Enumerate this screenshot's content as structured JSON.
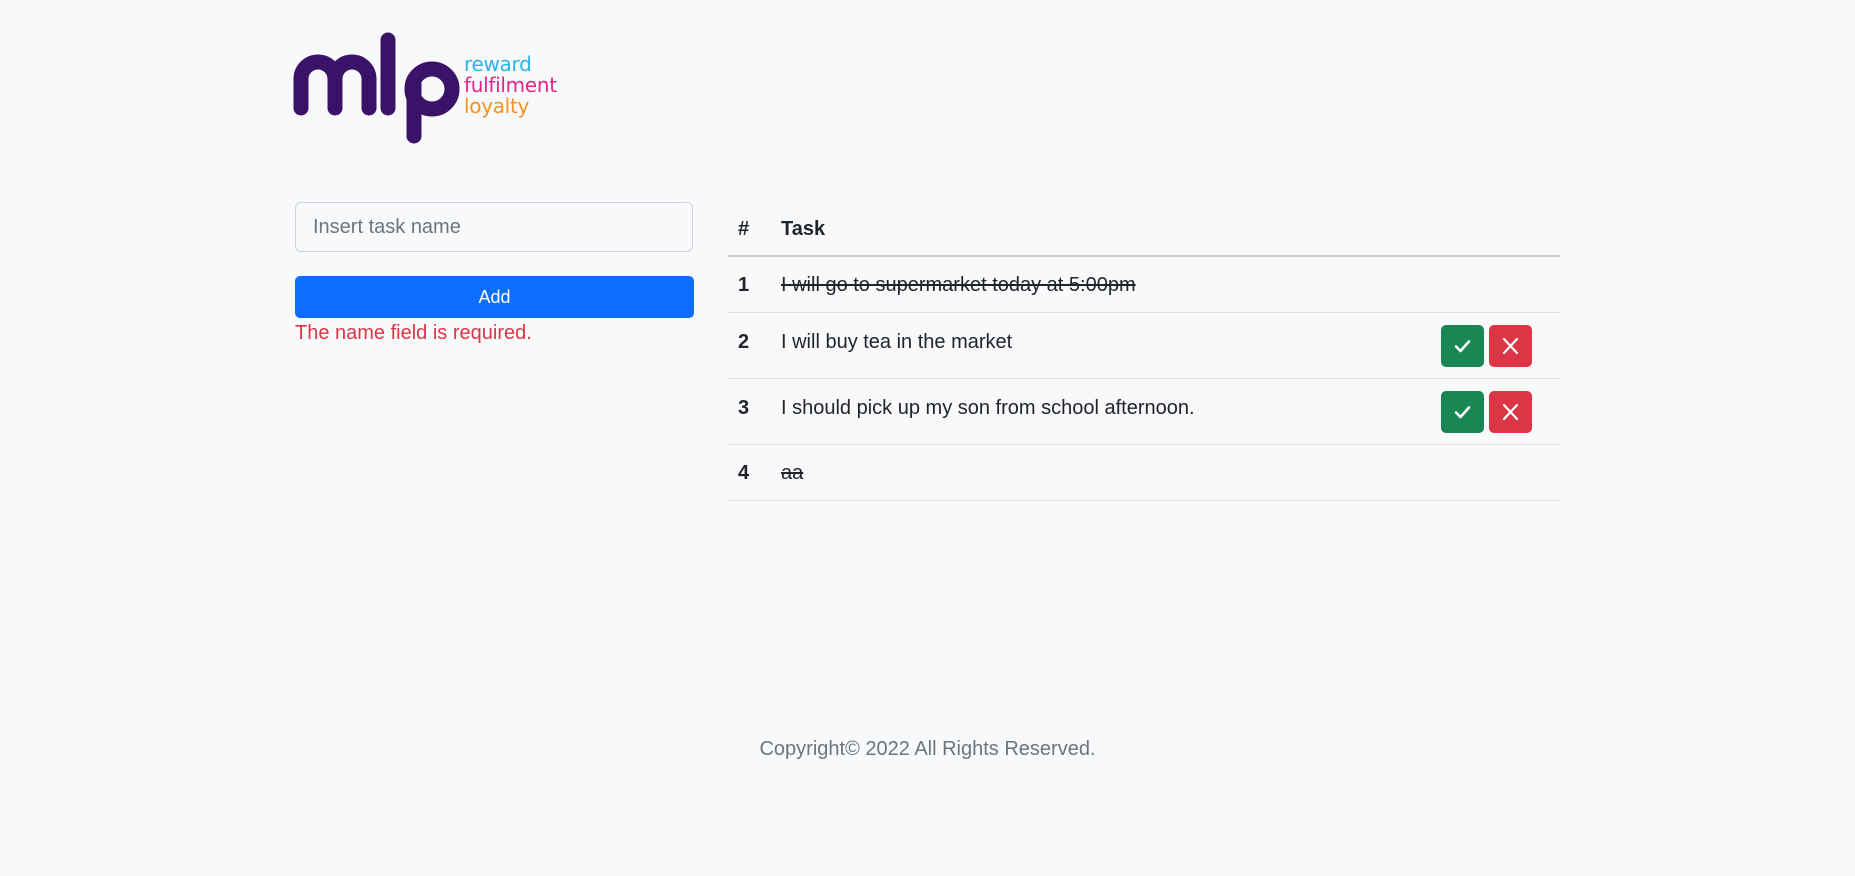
{
  "brand": {
    "logo_text": "mlp",
    "tagline": [
      "reward",
      "fulfilment",
      "loyalty"
    ],
    "colors": {
      "mark": "#3a1268",
      "reward": "#2bb5e6",
      "fulfilment": "#e7228a",
      "loyalty": "#f39221"
    }
  },
  "form": {
    "input_value": "",
    "input_placeholder": "Insert task name",
    "add_label": "Add",
    "error": "The name field is required."
  },
  "table": {
    "headers": [
      "#",
      "Task"
    ],
    "rows": [
      {
        "num": "1",
        "task": "I will go to supermarket today at 5:00pm",
        "done": true
      },
      {
        "num": "2",
        "task": "I will buy tea in the market",
        "done": false,
        "actions": [
          "check-icon",
          "close-icon"
        ]
      },
      {
        "num": "3",
        "task": "I should pick up my son from school afternoon.",
        "done": false,
        "actions": [
          "check-icon",
          "close-icon"
        ]
      },
      {
        "num": "4",
        "task": "aa",
        "done": true
      }
    ]
  },
  "footer": {
    "text": "Copyright© 2022 All Rights Reserved."
  },
  "colors": {
    "primary": "#0d6efd",
    "success": "#198754",
    "danger": "#dc3545",
    "muted": "#6c757d",
    "background": "#f8f9fa"
  }
}
